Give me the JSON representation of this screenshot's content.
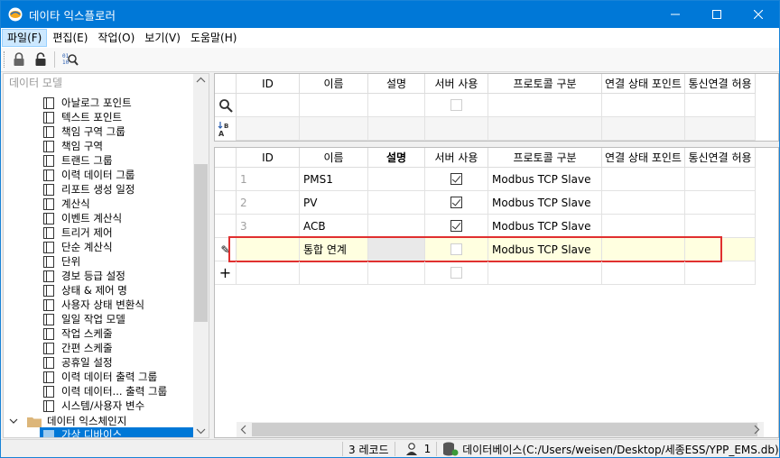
{
  "window": {
    "title": "데이타 익스플로러",
    "accent": "#0078d7",
    "controls": [
      "minimize-icon",
      "maximize-icon",
      "close-icon"
    ]
  },
  "menu": {
    "items": [
      "파일(F)",
      "편집(E)",
      "작업(O)",
      "보기(V)",
      "도움말(H)"
    ]
  },
  "toolbar": {
    "buttons": [
      "lock-icon",
      "unlock-icon",
      "binary-search-icon"
    ]
  },
  "tree": {
    "header": "데이터 모델",
    "items": [
      "아날로그 포인트",
      "텍스트 포인트",
      "책임 구역 그룹",
      "책임 구역",
      "트랜드 그룹",
      "이력 데이터 그룹",
      "리포트 생성 일정",
      "계산식",
      "이벤트 계산식",
      "트리거 제어",
      "단순 계산식",
      "단위",
      "경보 등급 설정",
      "상태 & 제어 명",
      "사용자 상태 변환식",
      "일일 작업 모델",
      "작업 스케줄",
      "간편 스케줄",
      "공휴일 설정",
      "이력 데이터 출력 그룹",
      "이력 데이터... 출력 그룹",
      "시스템/사용자 변수"
    ],
    "folder": "데이터 익스체인지",
    "selected_child": "가상 디바이스"
  },
  "grid_top": {
    "columns": [
      "ID",
      "이름",
      "설명",
      "서버 사용",
      "프로토콜 구분",
      "연결 상태 포인트",
      "통신연결 허용"
    ],
    "row_icons": [
      "search-icon",
      "sort-az-icon"
    ]
  },
  "grid_bottom": {
    "columns": [
      "ID",
      "이름",
      "설명",
      "서버 사용",
      "프로토콜 구분",
      "연결 상태 포인트",
      "통신연결 허용"
    ],
    "rows": [
      {
        "id": "1",
        "name": "PMS1",
        "desc": "",
        "enabled": true,
        "protocol": "Modbus TCP Slave"
      },
      {
        "id": "2",
        "name": "PV",
        "desc": "",
        "enabled": true,
        "protocol": "Modbus TCP Slave"
      },
      {
        "id": "3",
        "name": "ACB",
        "desc": "",
        "enabled": true,
        "protocol": "Modbus TCP Slave"
      },
      {
        "id": "",
        "name": "통합 연계",
        "desc": "",
        "enabled": false,
        "protocol": "Modbus TCP Slave"
      }
    ],
    "new_row_marker": "+",
    "editing_marker": "✎",
    "highlight_color": "#ffffe0",
    "highlight_border": "#e03030"
  },
  "status": {
    "records": "3 레코드",
    "users": "1",
    "database": "데이터베이스(C:/Users/weisen/Desktop/세종ESS/YPP_EMS.db)"
  }
}
